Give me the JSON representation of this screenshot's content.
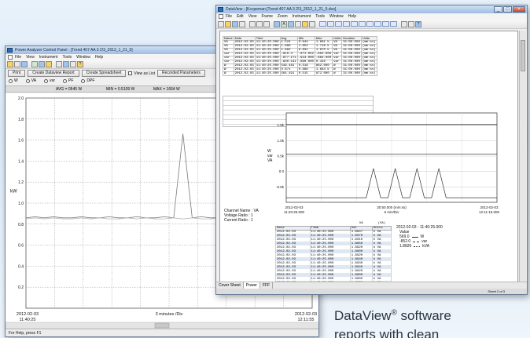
{
  "left_window": {
    "title": "Power Analyzer Control Panel - [Trend 407 AA 3 2!3_2012_1_21_5]",
    "menu": [
      "File",
      "View",
      "Instrument",
      "Tools",
      "Window",
      "Help"
    ],
    "buttons": {
      "print": "Print",
      "create_dataview": "Create Dataview Report",
      "create_spreadsheet": "Create Spreadsheet",
      "view_as_list": "View as List",
      "recorded_params": "Recorded Parameters"
    },
    "selectors": [
      "W",
      "VA",
      "var",
      "PF",
      "DPF"
    ],
    "stats": {
      "avg": "AVG = 0545 W",
      "min": "MIN = 0.5109 W",
      "max": "MAX = 1664 W"
    },
    "statusbar": "For Help, press F1"
  },
  "right_window": {
    "title": "DataView - [Kccpeman [Trend 407 AA 3 2!3_2012_1_21_5.dvo]",
    "menu": [
      "File",
      "Edit",
      "View",
      "Frame",
      "Zoom",
      "Instrument",
      "Tools",
      "Window",
      "Help"
    ],
    "tabs": [
      "Cover Sheet",
      "Power",
      "FFF"
    ],
    "status_page": "Sheet 2 of 3"
  },
  "summary_table": {
    "headers": [
      "Name",
      "Date",
      "Time",
      "Avg",
      "Min",
      "Max",
      "Units",
      "Duration",
      "Units"
    ],
    "rows": [
      [
        "VA",
        "2012-02-03",
        "11:40:25.000",
        "1.524",
        "0.644",
        "1.681 k",
        "VA",
        "31:00.000",
        "(mm:ss)"
      ],
      [
        "VA",
        "2012-02-03",
        "11:40:25.000",
        "1.880",
        "1.652",
        "1.716 k",
        "VA",
        "31:00.000",
        "(mm:ss)"
      ],
      [
        "VA",
        "2012-02-03",
        "11:40:25.000",
        "1.892",
        "0.831",
        "1.870 k",
        "VA",
        "31:00.000",
        "(mm:ss)"
      ],
      [
        "var",
        "2012-02-03",
        "11:40:25.000",
        "-810.4",
        "-871.052",
        "-802.000",
        "var",
        "31:00.000",
        "(mm:ss)"
      ],
      [
        "var",
        "2012-02-03",
        "11:40:25.000",
        "-877.171",
        "-913.000",
        "-864.000",
        "var",
        "31:00.000",
        "(mm:ss)"
      ],
      [
        "var",
        "2012-02-03",
        "11:40:25.000",
        "-830.131",
        "-860.000",
        "0.102",
        "var",
        "31:00.000",
        "(mm:ss)"
      ],
      [
        "W",
        "2012-02-03",
        "11:40:25.000",
        "549.481",
        "0.518",
        "862.000",
        "W",
        "31:00.000",
        "(mm:ss)"
      ],
      [
        "W",
        "2012-02-03",
        "11:40:25.000",
        "0.871",
        "0.888",
        "1.664 k",
        "W",
        "31:00.000",
        "(mm:ss)"
      ],
      [
        "W",
        "2012-02-03",
        "11:40:25.000",
        "564.491",
        "0.515",
        "872.000",
        "W",
        "31:00.000",
        "(mm:ss)"
      ]
    ]
  },
  "info": {
    "channel": "Channel Name : VA",
    "voltage": "Voltage Ratio : 1",
    "current": "Current Ratio : 1"
  },
  "data_table": {
    "super": [
      "VA",
      "(VA)"
    ],
    "headers": [
      "Date",
      "Time",
      "Val",
      "Units"
    ],
    "rows": [
      [
        "2012-02-03",
        "11:40:25.000",
        "1.8847",
        "k VA"
      ],
      [
        "2012-02-03",
        "11:40:25.000",
        "1.8070",
        "k VA"
      ],
      [
        "2012-02-03",
        "11:40:25.000",
        "1.9010",
        "k VA"
      ],
      [
        "2012-02-03",
        "11:40:25.000",
        "1.8950",
        "k VA"
      ],
      [
        "2012-02-03",
        "11:40:25.000",
        "1.8920",
        "k VA"
      ],
      [
        "2012-02-03",
        "11:40:25.000",
        "1.8900",
        "k VA"
      ],
      [
        "2012-02-03",
        "11:40:25.000",
        "1.8920",
        "k VA"
      ],
      [
        "2012-02-03",
        "11:40:25.000",
        "1.8940",
        "k VA"
      ],
      [
        "2012-02-03",
        "11:40:25.000",
        "1.8930",
        "k VA"
      ],
      [
        "2012-02-03",
        "11:40:25.000",
        "1.8940",
        "k VA"
      ],
      [
        "2012-02-03",
        "11:40:25.000",
        "1.8920",
        "k VA"
      ],
      [
        "2012-02-03",
        "11:40:25.000",
        "1.8900",
        "k VA"
      ],
      [
        "2012-02-03",
        "11:40:25.000",
        "1.8900",
        "k VA"
      ],
      [
        "2012-02-03",
        "11:40:25.000",
        "1.8930",
        "k VA"
      ],
      [
        "2012-02-03",
        "11:40:25.000",
        "1.8920",
        "k VA"
      ]
    ]
  },
  "legend": {
    "timestamp": "2012-02-03 - 11:40:25.000",
    "value_label": "Value",
    "entries": [
      {
        "value": "569.0",
        "unit": "W"
      },
      {
        "value": "-852.0",
        "unit": "var"
      },
      {
        "value": "1.8826",
        "unit": "kVA"
      }
    ]
  },
  "caption": {
    "line1": "DataView",
    "reg": "®",
    "line1b": " software",
    "line2": "reports with clean"
  },
  "chart_data": [
    {
      "type": "line",
      "ylabel": "kW",
      "ylim": [
        0,
        2.0
      ],
      "yticks": [
        "2.0",
        "1.8",
        "1.6",
        "1.4",
        "1.2",
        "1.0",
        "0.8",
        "0.6",
        "0.4",
        "0.2"
      ],
      "xticks": [
        {
          "lines": [
            "2012-02-03",
            "11:40:25"
          ]
        },
        {
          "lines": [
            "3 minutes /Div"
          ]
        },
        {
          "lines": [
            "2012-02-03",
            "12:11:55"
          ]
        }
      ],
      "series": [
        {
          "values": [
            0.86,
            0.87,
            0.86,
            0.87,
            0.86,
            0.86,
            0.87,
            0.86,
            0.86,
            0.87,
            0.86,
            0.86,
            0.87,
            0.86,
            0.86,
            0.87,
            0.86,
            1.66,
            0.86,
            0.87,
            0.86,
            0.86,
            0.87,
            0.86,
            0.86,
            0.87,
            0.86,
            0.86,
            0.87,
            0.86,
            0.86,
            0.87
          ]
        },
        {
          "values": [
            0.85,
            0.86,
            0.85,
            0.86,
            0.85,
            0.85,
            0.86,
            0.85,
            0.86,
            0.85,
            0.85,
            0.86,
            0.85,
            0.86,
            0.85,
            0.85,
            0.86,
            0.85,
            0.86,
            0.85,
            0.85,
            0.86,
            0.85,
            0.86,
            0.85,
            0.85,
            0.86,
            0.85,
            0.86,
            0.85,
            0.85,
            0.86
          ]
        }
      ]
    },
    {
      "type": "line",
      "ylabel": "W var VA",
      "ylim": [
        -1.0,
        1.9
      ],
      "yticks": [
        "1.5k",
        "1.0k",
        "0.5k",
        "0.0",
        "-0.5k"
      ],
      "xticks": [
        {
          "lines": [
            "2012-02-03",
            "11:40:25.000"
          ]
        },
        {
          "lines": [
            "30:50.000 (mm:ss)",
            "6 min/Div"
          ]
        },
        {
          "lines": [
            "2012-02-03",
            "12:11:15.000"
          ]
        }
      ],
      "series": [
        {
          "name": "W",
          "values": [
            0.56,
            0.56,
            0.56,
            0.56,
            0.56,
            0.56,
            0.56,
            0.56,
            0.56,
            0.56,
            0.56,
            0.56,
            0.56,
            0.56,
            0.56,
            0.56,
            0.56,
            0.56,
            0.56,
            0.56,
            0.56,
            0.56,
            0.56,
            0.56,
            0.56,
            0.56,
            0.56,
            0.56,
            0.56,
            0.56
          ]
        },
        {
          "name": "var",
          "values": [
            -0.85,
            -0.85,
            -0.85,
            -0.85,
            -0.85,
            -0.85,
            -0.85,
            -0.85,
            -0.85,
            -0.85,
            -0.85,
            -0.85,
            0.1,
            -0.85,
            -0.85,
            0.1,
            -0.85,
            -0.85,
            0.1,
            -0.85,
            -0.85,
            0.1,
            -0.85,
            -0.85,
            -0.85,
            -0.85,
            -0.85,
            -0.85,
            -0.85,
            -0.85
          ]
        },
        {
          "name": "VA",
          "values": [
            1.52,
            1.52,
            1.52,
            1.52,
            1.52,
            1.52,
            1.52,
            1.52,
            1.52,
            1.52,
            1.52,
            1.52,
            1.52,
            1.52,
            1.52,
            1.52,
            1.52,
            1.52,
            1.52,
            1.52,
            1.52,
            1.52,
            1.52,
            1.52,
            1.52,
            1.52,
            1.52,
            1.52,
            1.52,
            1.52
          ]
        }
      ]
    }
  ]
}
